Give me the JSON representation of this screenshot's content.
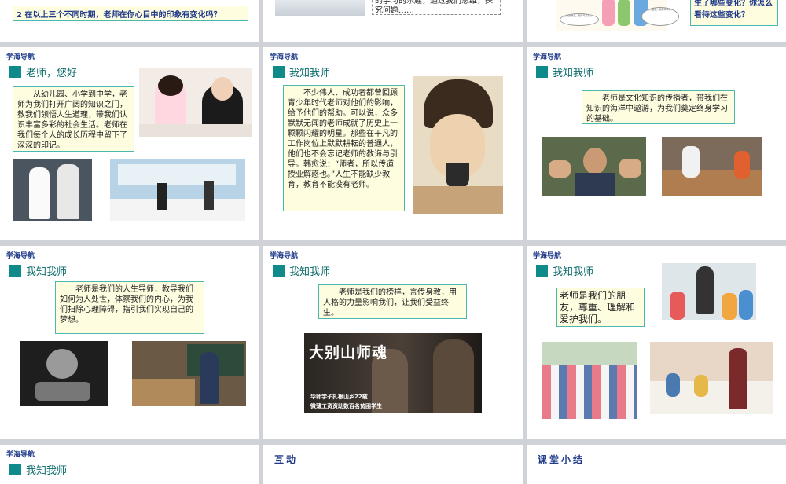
{
  "nav_label": "学海导航",
  "section_title": "我知我师",
  "row0": {
    "left_question": "2 在以上三个不同时期，老师在你心目中的印象有变化吗？",
    "mid_text": "的学习的乐趣，通过我们思维，探究问题……",
    "bubble_left": "看我的作品，老师可喜欢了！",
    "bubble_right": "老师不要我，我就乖乖地……",
    "right_question": "生了哪些变化？你怎么看待这些变化？"
  },
  "s1": {
    "title": "老师，您好",
    "text": "从幼儿园、小学到中学，老师为我们打开广阔的知识之门，教我们领悟人生道理，带我们认识丰富多彩的社会生活。老师在我们每个人的成长历程中留下了深深的印记。"
  },
  "s2": {
    "text": "不少伟人、成功者都曾回顾青少年时代老师对他们的影响，给予他们的帮助。可以说，众多默默无闻的老师成就了历史上一颗颗闪耀的明星。那些在平凡的工作岗位上默默耕耘的普通人，他们也不会忘记老师的教诲与引导。韩愈说：“师者，所以传道授业解惑也。”人生不能缺少教育，教育不能没有老师。"
  },
  "s3": {
    "text": "老师是文化知识的传播者，带我们在知识的海洋中遨游，为我们奠定终身学习的基础。"
  },
  "s4": {
    "text": "老师是我们的人生导师，教导我们如何为人处世，体察我们的内心，为我们扫除心理障碍，指引我们实现自己的梦想。"
  },
  "s5": {
    "text": "老师是我们的榜样，言传身教，用人格的力量影响我们，让我们受益终生。",
    "photo_title": "大别山师魂",
    "photo_caption_1": "华师学子扎根山乡22载",
    "photo_caption_2": "微薄工资资助数百名贫困学生"
  },
  "s6": {
    "text": "老师是我们的朋友，尊重、理解和爱护我们。"
  },
  "s7": {
    "title": "我知我师"
  },
  "s8": {
    "title": "互动"
  },
  "s9": {
    "title": "课堂小结"
  }
}
